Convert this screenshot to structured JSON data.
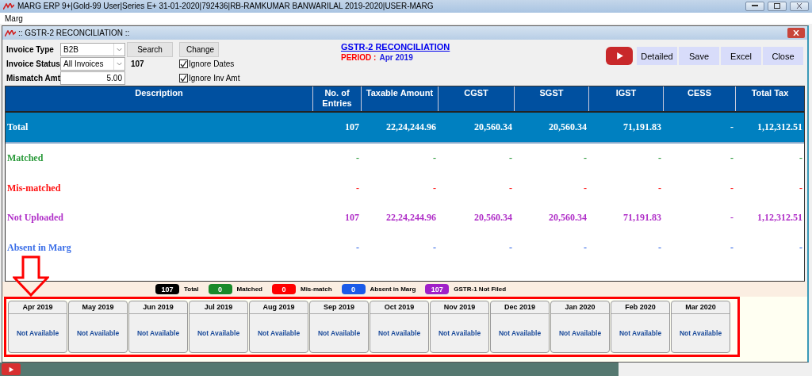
{
  "app_title": "MARG ERP 9+|Gold-99 User|Series E+ 31-01-2020|792436|RB-RAMKUMAR BANWARILAL 2019-2020|USER-MARG",
  "menu": [
    "Marg"
  ],
  "window_title": ":: GSTR-2 RECONCILIATION ::",
  "filters": {
    "invoice_type_label": "Invoice Type",
    "invoice_type": "B2B",
    "invoice_status_label": "Invoice Status",
    "invoice_status": "All Invoices",
    "count": "107",
    "mismatch_label": "Mismatch Amt",
    "mismatch_amt": "5.00",
    "search": "Search",
    "change": "Change",
    "checks": [
      {
        "label": "Ignore Dates",
        "checked": true
      },
      {
        "label": "Ignore Inv Amt",
        "checked": true
      }
    ]
  },
  "report_title": "GSTR-2 RECONCILIATION",
  "period_label": "PERIOD :",
  "period": "Apr 2019",
  "actions": [
    "Detailed",
    "Save",
    "Excel",
    "Close"
  ],
  "table": {
    "columns": [
      [
        "Description"
      ],
      [
        "No. of",
        "Entries"
      ],
      [
        "Taxable Amount"
      ],
      [
        "CGST"
      ],
      [
        "SGST"
      ],
      [
        "IGST"
      ],
      [
        "CESS"
      ],
      [
        "Total Tax"
      ]
    ],
    "rows": [
      {
        "label": "Total",
        "kind": "total",
        "color": "#ffffff",
        "values": [
          "107",
          "22,24,244.96",
          "20,560.34",
          "20,560.34",
          "71,191.83",
          "-",
          "1,12,312.51"
        ]
      },
      {
        "label": "Matched",
        "kind": "plain",
        "color": "#2a9a3a",
        "values": [
          "-",
          "-",
          "-",
          "-",
          "-",
          "-",
          "-"
        ]
      },
      {
        "label": "Mis-matched",
        "kind": "plain",
        "color": "#ff1010",
        "values": [
          "-",
          "-",
          "-",
          "-",
          "-",
          "-",
          "-"
        ]
      },
      {
        "label": "Not Uploaded",
        "kind": "plain",
        "color": "#b030c8",
        "values": [
          "107",
          "22,24,244.96",
          "20,560.34",
          "20,560.34",
          "71,191.83",
          "-",
          "1,12,312.51"
        ]
      },
      {
        "label": "Absent in Marg",
        "kind": "plain",
        "color": "#3a6ee8",
        "values": [
          "-",
          "-",
          "-",
          "-",
          "-",
          "-",
          "-"
        ]
      }
    ]
  },
  "legend": [
    {
      "count": "107",
      "label": "Total",
      "color": "#000000"
    },
    {
      "count": "0",
      "label": "Matched",
      "color": "#1a8a2a"
    },
    {
      "count": "0",
      "label": "Mis-match",
      "color": "#ff0000"
    },
    {
      "count": "0",
      "label": "Absent in Marg",
      "color": "#1a5ae8"
    },
    {
      "count": "107",
      "label": "GSTR-1 Not Filed",
      "color": "#a020c8"
    }
  ],
  "months": [
    {
      "month": "Apr 2019",
      "status": "Not Available"
    },
    {
      "month": "May 2019",
      "status": "Not Available"
    },
    {
      "month": "Jun 2019",
      "status": "Not Available"
    },
    {
      "month": "Jul 2019",
      "status": "Not Available"
    },
    {
      "month": "Aug 2019",
      "status": "Not Available"
    },
    {
      "month": "Sep 2019",
      "status": "Not Available"
    },
    {
      "month": "Oct 2019",
      "status": "Not Available"
    },
    {
      "month": "Nov 2019",
      "status": "Not Available"
    },
    {
      "month": "Dec 2019",
      "status": "Not Available"
    },
    {
      "month": "Jan 2020",
      "status": "Not Available"
    },
    {
      "month": "Feb 2020",
      "status": "Not Available"
    },
    {
      "month": "Mar 2020",
      "status": "Not Available"
    }
  ]
}
